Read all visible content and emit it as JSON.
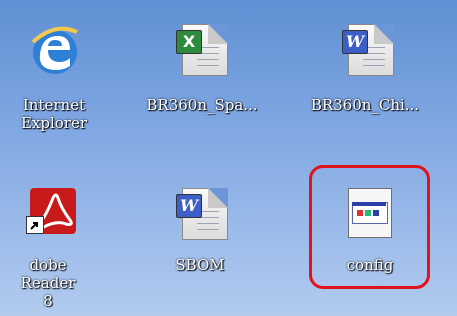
{
  "desktop": {
    "icons": [
      {
        "label": "Internet\nExplorer",
        "icon": "internet-explorer-icon"
      },
      {
        "label": "BR360n_Spa...",
        "icon": "excel-document-icon",
        "badge": "X"
      },
      {
        "label": "BR360n_Chi...",
        "icon": "word-document-icon",
        "badge": "W"
      },
      {
        "label": "dobe Reader\n8",
        "icon": "adobe-reader-icon"
      },
      {
        "label": "SBOM",
        "icon": "word-document-icon",
        "badge": "W"
      },
      {
        "label": "config",
        "icon": "config-file-icon"
      }
    ]
  },
  "colors": {
    "excel_green": "#2e8b3e",
    "word_blue": "#3b5fc7",
    "adobe_red": "#c81a1a",
    "highlight_red": "#e0121b"
  }
}
